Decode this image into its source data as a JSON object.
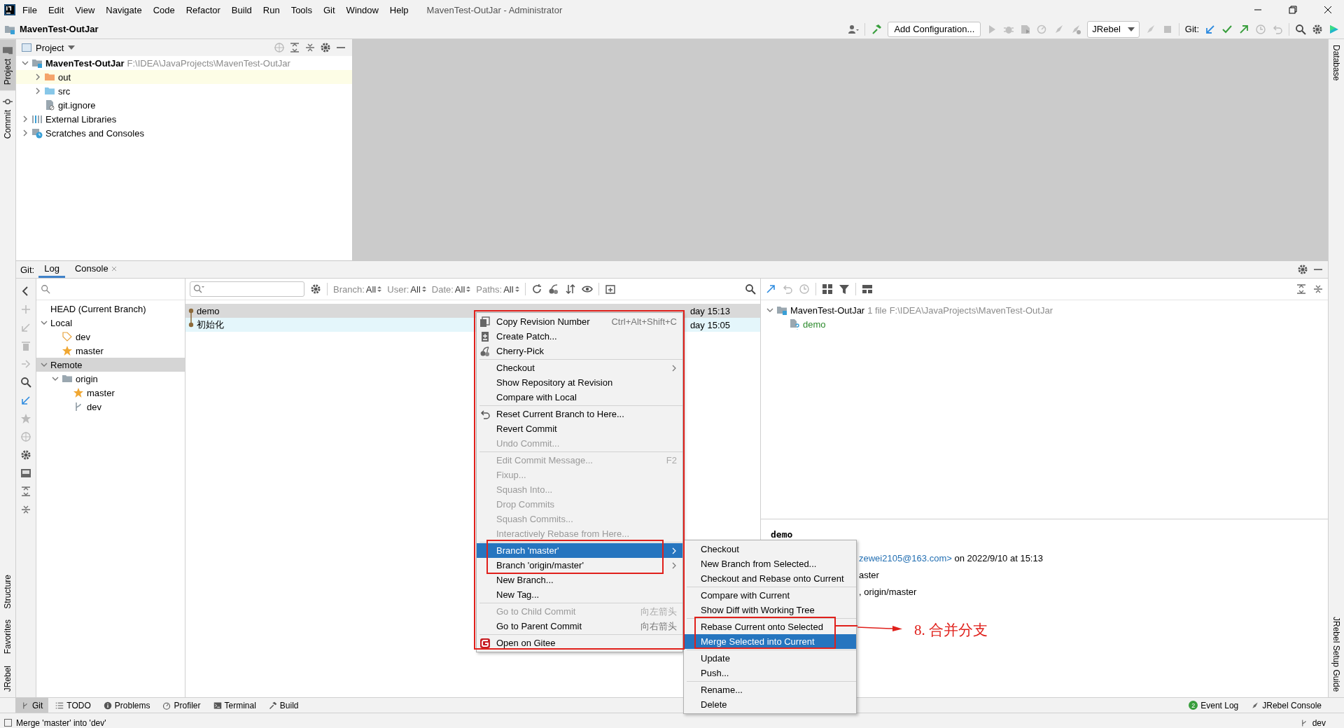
{
  "window": {
    "title": "MavenTest-OutJar - Administrator"
  },
  "menu_bar": [
    "File",
    "Edit",
    "View",
    "Navigate",
    "Code",
    "Refactor",
    "Build",
    "Run",
    "Tools",
    "Git",
    "Window",
    "Help"
  ],
  "breadcrumb": "MavenTest-OutJar",
  "toolbar": {
    "add_configuration": "Add Configuration...",
    "run_config": "JRebel",
    "git_label": "Git:"
  },
  "left_strip_top": [
    {
      "label": "Project",
      "selected": true
    },
    {
      "label": "Commit",
      "selected": false
    }
  ],
  "left_strip_bottom": [
    "Structure",
    "Favorites",
    "JRebel"
  ],
  "right_strip_top": "Database",
  "right_strip_bottom": "JRebel Setup Guide",
  "project_panel": {
    "title": "Project",
    "tree": [
      {
        "name": "MavenTest-OutJar",
        "path": "F:\\IDEA\\JavaProjects\\MavenTest-OutJar",
        "kind": "module",
        "expanded": true,
        "highlighted": false,
        "children": [
          {
            "name": "out",
            "kind": "excluded-folder",
            "expanded": false,
            "highlighted": true
          },
          {
            "name": "src",
            "kind": "folder",
            "expanded": false,
            "highlighted": false
          },
          {
            "name": "git.ignore",
            "kind": "ignored-file",
            "highlighted": false
          }
        ]
      },
      {
        "name": "External Libraries",
        "kind": "library",
        "expanded": false,
        "highlighted": false
      },
      {
        "name": "Scratches and Consoles",
        "kind": "scratches",
        "expanded": false,
        "highlighted": false
      }
    ]
  },
  "git_panel": {
    "label": "Git:",
    "tabs": [
      {
        "label": "Log",
        "selected": true,
        "closable": false
      },
      {
        "label": "Console",
        "selected": false,
        "closable": true
      }
    ]
  },
  "branches": [
    {
      "name": "HEAD (Current Branch)",
      "selected": false
    },
    {
      "name": "Local",
      "expanded": true,
      "selected": false,
      "children": [
        {
          "name": "dev",
          "kind": "current",
          "selected": false
        },
        {
          "name": "master",
          "kind": "favorite",
          "selected": false
        }
      ]
    },
    {
      "name": "Remote",
      "expanded": true,
      "selected": true,
      "children": [
        {
          "name": "origin",
          "kind": "folder",
          "expanded": true,
          "selected": false,
          "children": [
            {
              "name": "master",
              "kind": "favorite",
              "selected": false
            },
            {
              "name": "dev",
              "kind": "branch",
              "selected": false
            }
          ]
        }
      ]
    }
  ],
  "log_filters": [
    {
      "label": "Branch:",
      "value": "All"
    },
    {
      "label": "User:",
      "value": "All"
    },
    {
      "label": "Date:",
      "value": "All"
    },
    {
      "label": "Paths:",
      "value": "All"
    }
  ],
  "commits": [
    {
      "message": "demo",
      "date": "day 15:13",
      "selected": true,
      "highlighted": false
    },
    {
      "message": "初始化",
      "date": "day 15:05",
      "selected": false,
      "highlighted": true
    }
  ],
  "changes": {
    "name": "MavenTest-OutJar",
    "count": "1 file",
    "path": "F:\\IDEA\\JavaProjects\\MavenTest-OutJar",
    "expanded": true,
    "children": [
      {
        "name": "demo"
      }
    ]
  },
  "commit_details": {
    "subject": "demo",
    "email": "zewei2105@163.com>",
    "date_text": "on 2022/9/10 at 15:13",
    "line_2": "aster",
    "line_3": ", origin/master"
  },
  "context_menu": [
    {
      "kind": "item",
      "label": "Copy Revision Number",
      "shortcut": "Ctrl+Alt+Shift+C",
      "disabled": false,
      "submenu": false,
      "selected": false
    },
    {
      "kind": "item",
      "label": "Create Patch...",
      "disabled": false,
      "submenu": false,
      "selected": false
    },
    {
      "kind": "item",
      "label": "Cherry-Pick",
      "disabled": false,
      "submenu": false,
      "selected": false
    },
    {
      "kind": "separator"
    },
    {
      "kind": "item",
      "label": "Checkout",
      "disabled": false,
      "submenu": true,
      "selected": false
    },
    {
      "kind": "item",
      "label": "Show Repository at Revision",
      "disabled": false,
      "submenu": false,
      "selected": false
    },
    {
      "kind": "item",
      "label": "Compare with Local",
      "disabled": false,
      "submenu": false,
      "selected": false
    },
    {
      "kind": "separator"
    },
    {
      "kind": "item",
      "label": "Reset Current Branch to Here...",
      "disabled": false,
      "submenu": false,
      "selected": false
    },
    {
      "kind": "item",
      "label": "Revert Commit",
      "disabled": false,
      "submenu": false,
      "selected": false
    },
    {
      "kind": "item",
      "label": "Undo Commit...",
      "disabled": true,
      "submenu": false,
      "selected": false
    },
    {
      "kind": "separator"
    },
    {
      "kind": "item",
      "label": "Edit Commit Message...",
      "shortcut": "F2",
      "disabled": true,
      "submenu": false,
      "selected": false
    },
    {
      "kind": "item",
      "label": "Fixup...",
      "disabled": true,
      "submenu": false,
      "selected": false
    },
    {
      "kind": "item",
      "label": "Squash Into...",
      "disabled": true,
      "submenu": false,
      "selected": false
    },
    {
      "kind": "item",
      "label": "Drop Commits",
      "disabled": true,
      "submenu": false,
      "selected": false
    },
    {
      "kind": "item",
      "label": "Squash Commits...",
      "disabled": true,
      "submenu": false,
      "selected": false
    },
    {
      "kind": "item",
      "label": "Interactively Rebase from Here...",
      "disabled": true,
      "submenu": false,
      "selected": false
    },
    {
      "kind": "separator"
    },
    {
      "kind": "item",
      "label": "Branch 'master'",
      "disabled": false,
      "submenu": true,
      "selected": true
    },
    {
      "kind": "item",
      "label": "Branch 'origin/master'",
      "disabled": false,
      "submenu": true,
      "selected": false
    },
    {
      "kind": "item",
      "label": "New Branch...",
      "disabled": false,
      "submenu": false,
      "selected": false
    },
    {
      "kind": "item",
      "label": "New Tag...",
      "disabled": false,
      "submenu": false,
      "selected": false
    },
    {
      "kind": "separator"
    },
    {
      "kind": "item",
      "label": "Go to Child Commit",
      "shortcut": "向左箭头",
      "disabled": true,
      "submenu": false,
      "selected": false
    },
    {
      "kind": "item",
      "label": "Go to Parent Commit",
      "shortcut": "向右箭头",
      "disabled": false,
      "submenu": false,
      "selected": false
    },
    {
      "kind": "separator"
    },
    {
      "kind": "item",
      "label": "Open on Gitee",
      "disabled": false,
      "submenu": false,
      "selected": false
    }
  ],
  "submenu": [
    {
      "kind": "item",
      "label": "Checkout",
      "selected": false
    },
    {
      "kind": "item",
      "label": "New Branch from Selected...",
      "selected": false
    },
    {
      "kind": "item",
      "label": "Checkout and Rebase onto Current",
      "selected": false
    },
    {
      "kind": "separator"
    },
    {
      "kind": "item",
      "label": "Compare with Current",
      "selected": false
    },
    {
      "kind": "item",
      "label": "Show Diff with Working Tree",
      "selected": false
    },
    {
      "kind": "separator"
    },
    {
      "kind": "item",
      "label": "Rebase Current onto Selected",
      "selected": false
    },
    {
      "kind": "item",
      "label": "Merge Selected into Current",
      "selected": true
    },
    {
      "kind": "separator"
    },
    {
      "kind": "item",
      "label": "Update",
      "selected": false
    },
    {
      "kind": "item",
      "label": "Push...",
      "selected": false
    },
    {
      "kind": "separator"
    },
    {
      "kind": "item",
      "label": "Rename...",
      "selected": false
    },
    {
      "kind": "item",
      "label": "Delete",
      "selected": false
    }
  ],
  "annotation": {
    "label": "8. 合并分支"
  },
  "bottom_tools": [
    {
      "label": "Git",
      "selected": true
    },
    {
      "label": "TODO",
      "selected": false
    },
    {
      "label": "Problems",
      "selected": false
    },
    {
      "label": "Profiler",
      "selected": false
    },
    {
      "label": "Terminal",
      "selected": false
    },
    {
      "label": "Build",
      "selected": false
    }
  ],
  "bottom_tools_right": [
    {
      "label": "Event Log",
      "badge": "2"
    },
    {
      "label": "JRebel Console"
    }
  ],
  "status_bar": {
    "message": "Merge 'master' into 'dev'",
    "branch": "dev"
  }
}
